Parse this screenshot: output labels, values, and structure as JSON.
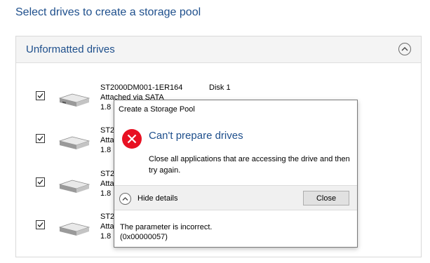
{
  "page": {
    "title": "Select drives to create a storage pool"
  },
  "panel": {
    "title": "Unformatted drives"
  },
  "drives": [
    {
      "name": "ST2000DM001-1ER164",
      "connection": "Attached via SATA",
      "size": "1.8",
      "disk": "Disk 1",
      "checked": true
    },
    {
      "name": "ST2",
      "connection": "Atta",
      "size": "1.8",
      "disk": "",
      "checked": true
    },
    {
      "name": "ST2",
      "connection": "Atta",
      "size": "1.8",
      "disk": "",
      "checked": true
    },
    {
      "name": "ST2",
      "connection": "Atta",
      "size": "1.8",
      "disk": "",
      "checked": true
    }
  ],
  "dialog": {
    "title": "Create a Storage Pool",
    "heading": "Can't prepare drives",
    "message": "Close all applications that are accessing the drive and then try again.",
    "toggle_label": "Hide details",
    "close_label": "Close",
    "details_line1": "The parameter is incorrect.",
    "details_line2": "(0x00000057)"
  },
  "colors": {
    "accent": "#1e4f8c",
    "error": "#e81123"
  }
}
